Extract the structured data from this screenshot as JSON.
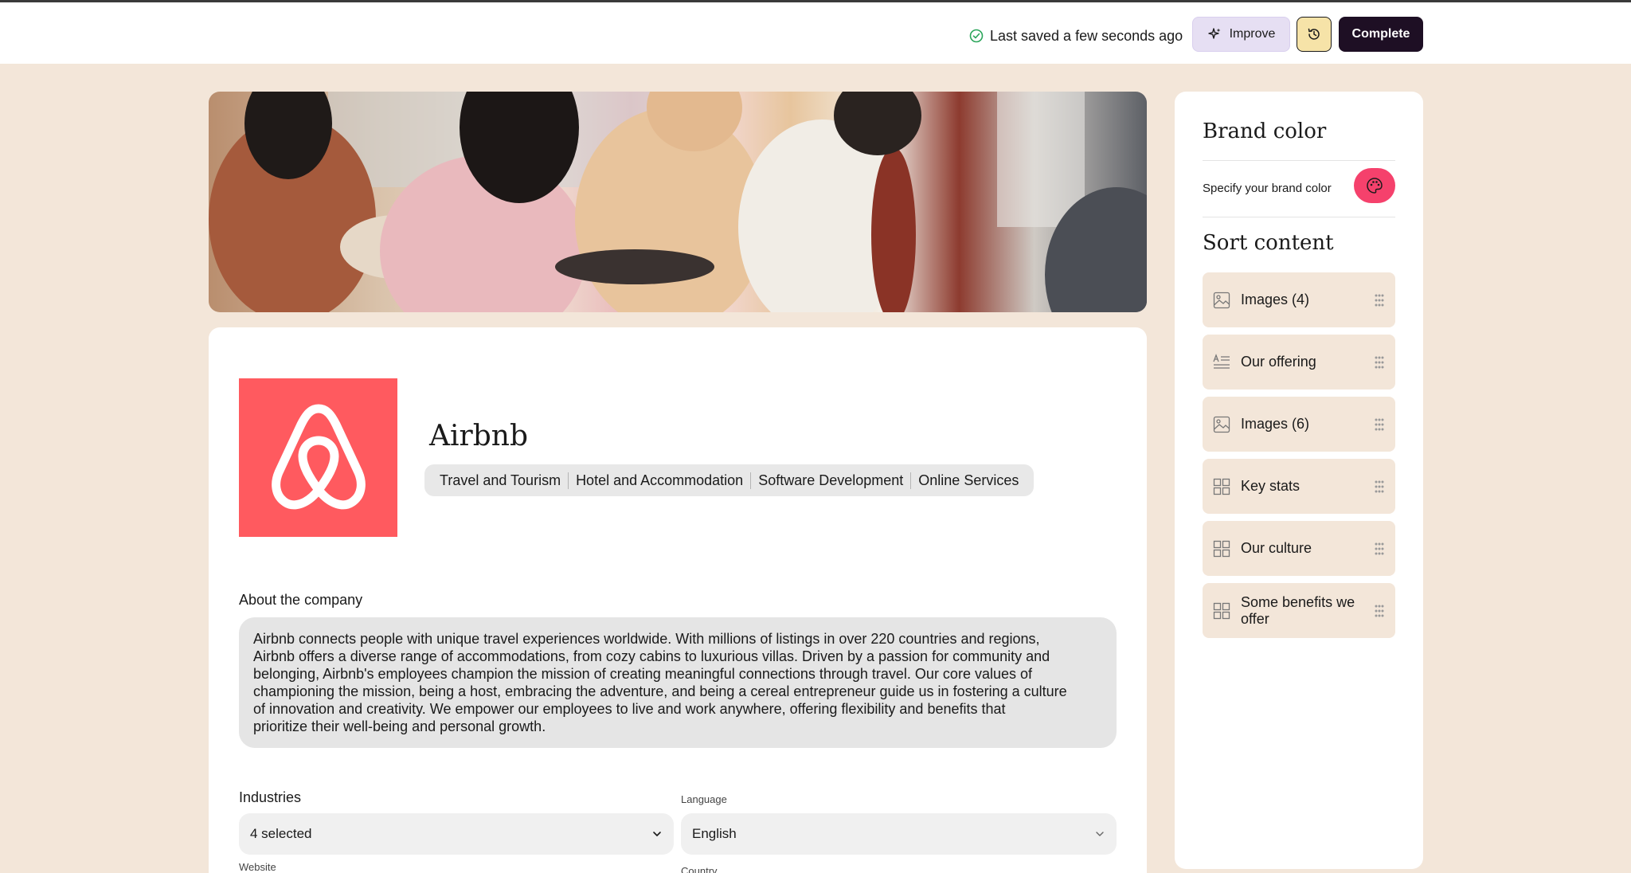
{
  "topbar": {
    "saved_status": "Last saved a few seconds ago",
    "improve_label": "Improve",
    "complete_label": "Complete"
  },
  "company": {
    "name": "Airbnb",
    "tags": [
      "Travel and Tourism",
      "Hotel and Accommodation",
      "Software Development",
      "Online Services"
    ],
    "about_label": "About the company",
    "about_text": "Airbnb connects people with unique travel experiences worldwide.  With millions of listings in over 220 countries and regions,\nAirbnb offers a diverse range of accommodations, from cozy cabins to luxurious villas. Driven by a passion for community and\nbelonging, Airbnb's employees champion the mission of creating meaningful connections through travel.  Our core values of\nchampioning the mission, being a host, embracing the adventure, and being a cereal entrepreneur guide us in fostering a culture\nof innovation and creativity.  We empower our employees to live and work anywhere, offering flexibility and benefits that\nprioritize their well-being and personal growth.",
    "brand_color": "#ff5a5f"
  },
  "form": {
    "industries_label": "Industries",
    "industries_value": "4 selected",
    "language_label": "Language",
    "language_value": "English",
    "website_label": "Website",
    "country_label": "Country"
  },
  "panel": {
    "brand_title": "Brand color",
    "brand_hint": "Specify your brand color",
    "palette_color": "#f5416c",
    "sort_title": "Sort content",
    "sort_items": [
      {
        "label": "Images (4)",
        "icon": "image-icon"
      },
      {
        "label": "Our offering",
        "icon": "text-icon"
      },
      {
        "label": "Images (6)",
        "icon": "image-icon"
      },
      {
        "label": "Key stats",
        "icon": "grid-icon"
      },
      {
        "label": "Our culture",
        "icon": "grid-icon"
      },
      {
        "label": "Some benefits we offer",
        "icon": "grid-icon"
      }
    ]
  },
  "colors": {
    "page_bg": "#f3e6d9",
    "complete_bg": "#1e0f24",
    "improve_bg": "#e6dff3",
    "history_bg": "#f6e3a8",
    "saved_check": "#2ba55a"
  }
}
